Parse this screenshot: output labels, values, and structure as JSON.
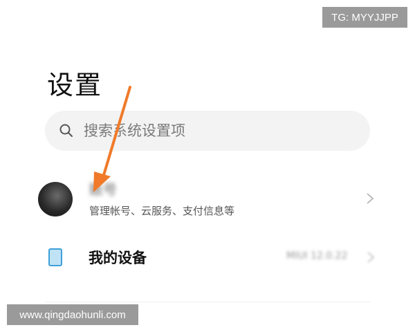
{
  "overlay": {
    "tg_badge": "TG: MYYJJPP",
    "watermark_url": "www.qingdaohunli.com"
  },
  "header": {
    "title": "设置"
  },
  "search": {
    "placeholder": "搜索系统设置项",
    "icon": "search-icon"
  },
  "account": {
    "name": "账号",
    "subtitle": "管理帐号、云服务、支付信息等",
    "icon": "avatar"
  },
  "device": {
    "label": "我的设备",
    "version": "MIUI 12.0.22",
    "icon": "phone-icon"
  },
  "colors": {
    "annotation_arrow": "#f07a2a",
    "device_icon": "#3f9fd9",
    "search_bg": "#f3f3f3"
  }
}
